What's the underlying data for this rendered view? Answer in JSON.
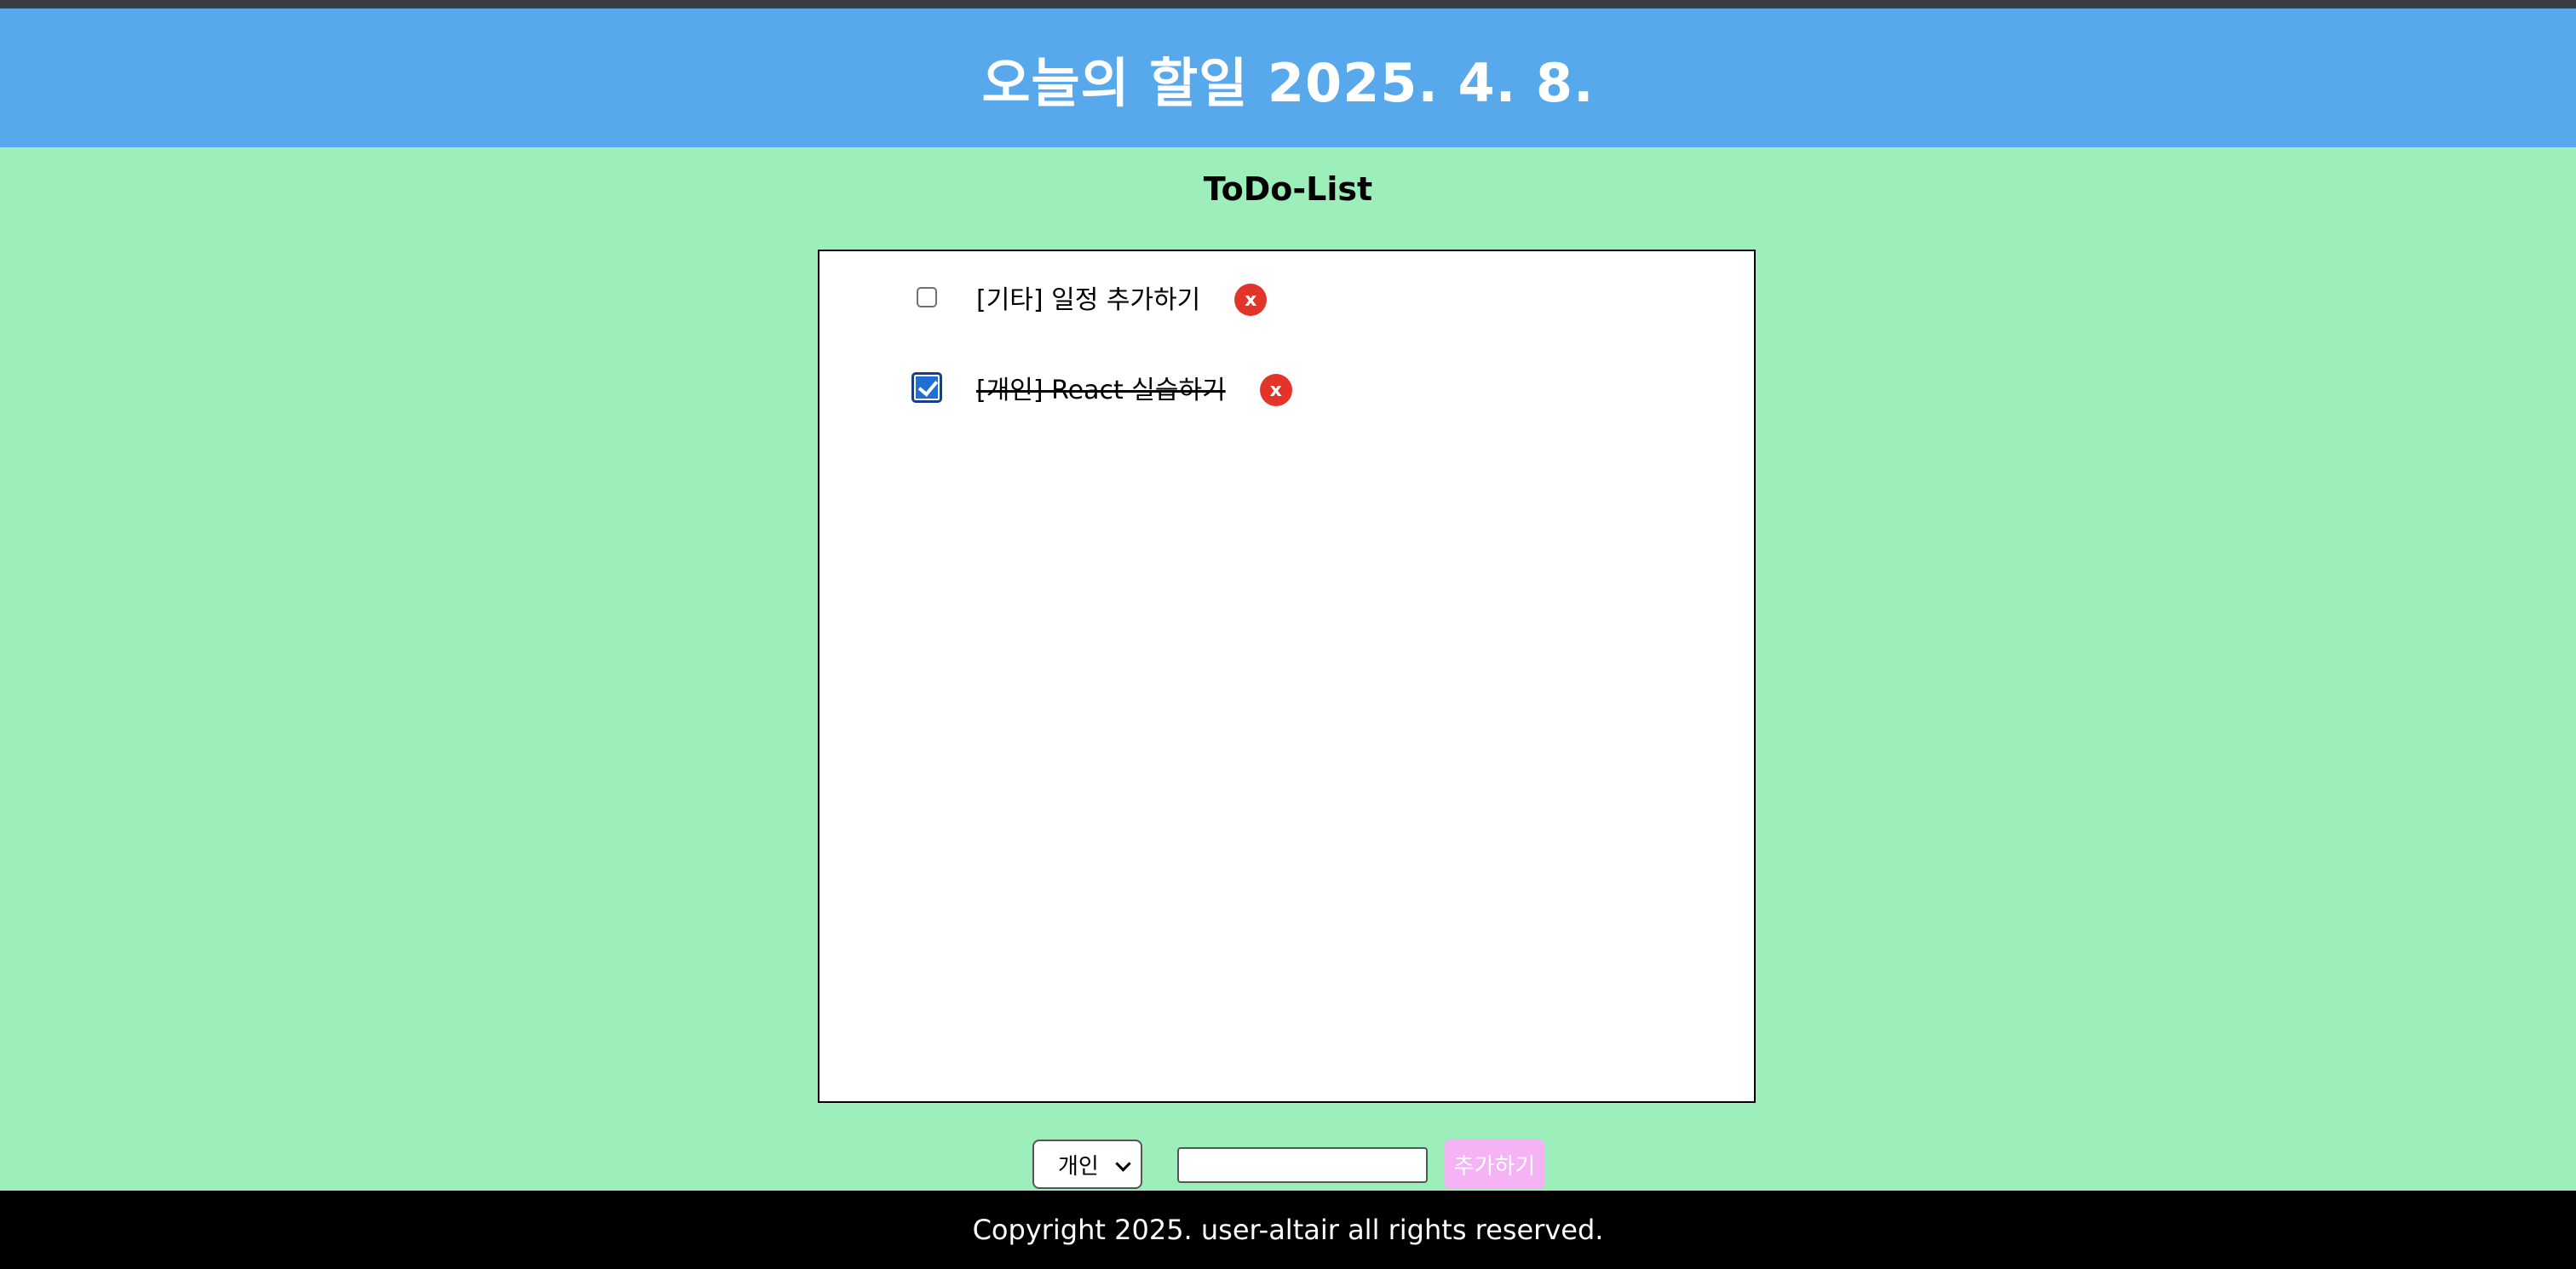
{
  "header": {
    "title": "오늘의 할일 2025. 4. 8."
  },
  "main": {
    "subtitle": "ToDo-List",
    "todos": [
      {
        "text": "[기타] 일정 추가하기",
        "done": false,
        "delete_label": "x"
      },
      {
        "text": "[개인] React 실습하기",
        "done": true,
        "delete_label": "x"
      }
    ]
  },
  "controls": {
    "category_selected": "개인",
    "input_value": "",
    "add_label": "추가하기"
  },
  "footer": {
    "copyright": "Copyright 2025. user-altair all rights reserved."
  },
  "colors": {
    "header_bg": "#58a8ec",
    "page_bg": "#9ceeba",
    "delete_btn": "#e3342a",
    "add_btn": "#f5b3f5",
    "footer_bg": "#000000"
  }
}
